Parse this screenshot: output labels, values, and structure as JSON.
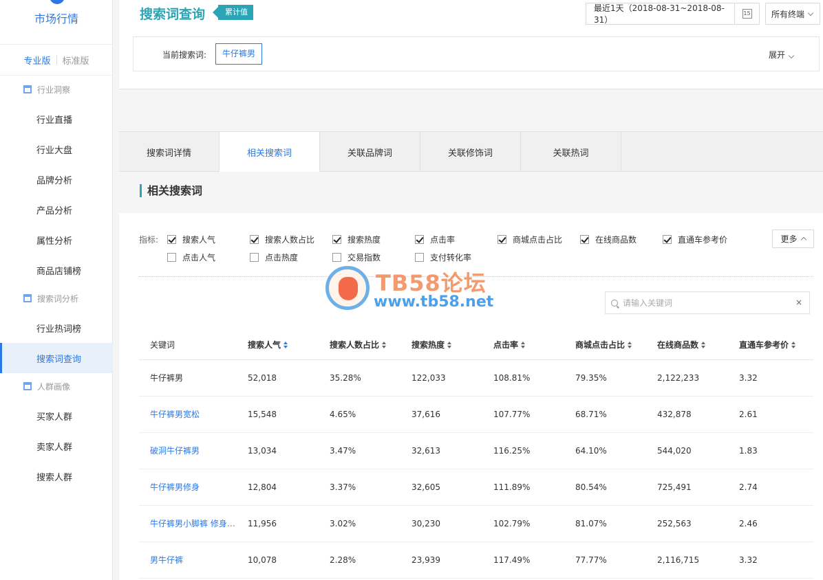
{
  "sidebar": {
    "app_title": "市场行情",
    "edition_pro": "专业版",
    "edition_std": "标准版",
    "groups": [
      "行业洞察",
      "搜索词分析",
      "人群画像"
    ],
    "items": [
      "行业直播",
      "行业大盘",
      "品牌分析",
      "产品分析",
      "属性分析",
      "商品店铺榜",
      "行业热词榜",
      "搜索词查询",
      "买家人群",
      "卖家人群",
      "搜索人群"
    ],
    "active_item": "搜索词查询"
  },
  "header": {
    "title": "搜索词查询",
    "badge": "累计值",
    "date_range": "最近1天（2018-08-31~2018-08-31）",
    "calendar_day": "15",
    "terminal": "所有终端",
    "current_label": "当前搜索词:",
    "current_keyword": "牛仔裤男",
    "expand": "展开"
  },
  "tabs": [
    "搜索词详情",
    "相关搜索词",
    "关联品牌词",
    "关联修饰词",
    "关联热词"
  ],
  "active_tab": "相关搜索词",
  "section": {
    "title": "相关搜索词",
    "indicator_label": "指标:",
    "indicators_checked": [
      "搜索人气",
      "搜索人数占比",
      "搜索热度",
      "点击率",
      "商城点击占比",
      "在线商品数",
      "直通车参考价"
    ],
    "indicators_unchecked": [
      "点击人气",
      "点击热度",
      "交易指数",
      "支付转化率"
    ],
    "more": "更多",
    "search_placeholder": "请输入关键词",
    "clear": "×"
  },
  "table": {
    "columns": [
      "关键词",
      "搜索人气",
      "搜索人数占比",
      "搜索热度",
      "点击率",
      "商城点击占比",
      "在线商品数",
      "直通车参考价"
    ],
    "rows": [
      [
        "牛仔裤男",
        "52,018",
        "35.28%",
        "122,033",
        "108.81%",
        "79.35%",
        "2,122,233",
        "3.32"
      ],
      [
        "牛仔裤男宽松",
        "15,548",
        "4.65%",
        "37,616",
        "107.77%",
        "68.71%",
        "432,878",
        "2.61"
      ],
      [
        "破洞牛仔裤男",
        "13,034",
        "3.47%",
        "32,613",
        "116.25%",
        "64.10%",
        "544,020",
        "1.83"
      ],
      [
        "牛仔裤男修身",
        "12,804",
        "3.37%",
        "32,605",
        "111.89%",
        "80.54%",
        "725,491",
        "2.74"
      ],
      [
        "牛仔裤男小脚裤 修身 ...",
        "11,956",
        "3.02%",
        "30,230",
        "102.79%",
        "81.07%",
        "252,563",
        "2.46"
      ],
      [
        "男牛仔裤",
        "10,078",
        "2.28%",
        "23,939",
        "117.49%",
        "77.77%",
        "2,116,715",
        "3.32"
      ]
    ]
  },
  "watermark": {
    "title": "TB58论坛",
    "url": "www.tb58.net"
  },
  "colors": {
    "accent": "#2b78e4",
    "title_teal": "#2aa6b3"
  }
}
